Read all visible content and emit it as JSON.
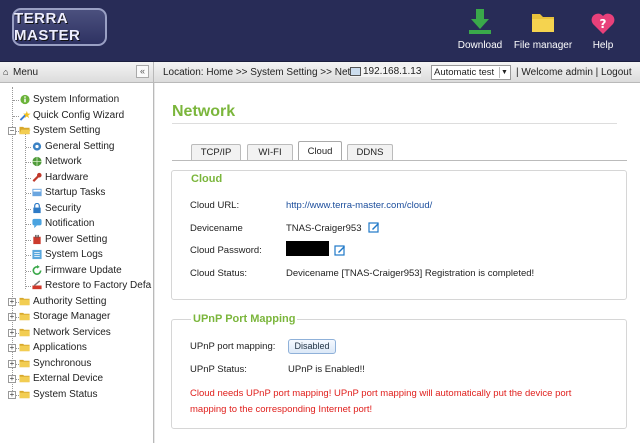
{
  "header": {
    "logo_text": "TERRA MASTER",
    "buttons": [
      {
        "label": "Download",
        "icon": "download-icon"
      },
      {
        "label": "File manager",
        "icon": "folder-icon"
      },
      {
        "label": "Help",
        "icon": "help-icon"
      }
    ]
  },
  "toolbar": {
    "menu_label": "Menu",
    "collapse_label": "«",
    "location": "Location: Home >> System Setting >> Net",
    "ip": "192.168.1.13",
    "mode": "Automatic test",
    "welcome": "| Welcome admin | Logout"
  },
  "sidebar": {
    "items": [
      {
        "label": "System Information",
        "icon": "info-icon"
      },
      {
        "label": "Quick Config Wizard",
        "icon": "wizard-icon"
      },
      {
        "label": "System Setting",
        "icon": "folder-open-icon"
      },
      {
        "label": "General Setting",
        "icon": "gear-icon"
      },
      {
        "label": "Network",
        "icon": "globe-icon"
      },
      {
        "label": "Hardware",
        "icon": "wrench-icon"
      },
      {
        "label": "Startup Tasks",
        "icon": "startup-icon"
      },
      {
        "label": "Security",
        "icon": "lock-icon"
      },
      {
        "label": "Notification",
        "icon": "notification-icon"
      },
      {
        "label": "Power Setting",
        "icon": "power-icon"
      },
      {
        "label": "System Logs",
        "icon": "logs-icon"
      },
      {
        "label": "Firmware Update",
        "icon": "refresh-icon"
      },
      {
        "label": "Restore to Factory Defa",
        "icon": "restore-icon"
      },
      {
        "label": "Authority Setting",
        "icon": "folder-icon"
      },
      {
        "label": "Storage Manager",
        "icon": "folder-icon"
      },
      {
        "label": "Network Services",
        "icon": "folder-icon"
      },
      {
        "label": "Applications",
        "icon": "folder-icon"
      },
      {
        "label": "Synchronous",
        "icon": "folder-icon"
      },
      {
        "label": "External Device",
        "icon": "folder-icon"
      },
      {
        "label": "System Status",
        "icon": "folder-icon"
      }
    ]
  },
  "main": {
    "title": "Network",
    "tabs": [
      "TCP/IP",
      "WI-FI",
      "Cloud",
      "DDNS"
    ],
    "active_tab": "Cloud",
    "cloud": {
      "title": "Cloud",
      "url_label": "Cloud URL:",
      "url_value": "http://www.terra-master.com/cloud/",
      "devicename_label": "Devicename",
      "devicename_value": "TNAS-Craiger953",
      "password_label": "Cloud Password:",
      "status_label": "Cloud Status:",
      "status_value": "Devicename [TNAS-Craiger953] Registration is completed!"
    },
    "upnp": {
      "title": "UPnP Port Mapping",
      "mapping_label": "UPnP port mapping:",
      "mapping_button": "Disabled",
      "status_label": "UPnP Status:",
      "status_value": "UPnP is Enabled!!",
      "warning": "Cloud needs UPnP port mapping! UPnP port mapping will automatically put the device port mapping to the corresponding Internet port!"
    }
  },
  "colors": {
    "header_bg": "#282c57",
    "accent_green": "#7bb63c",
    "link_blue": "#1c4e9c",
    "warning_red": "#e0201d"
  }
}
